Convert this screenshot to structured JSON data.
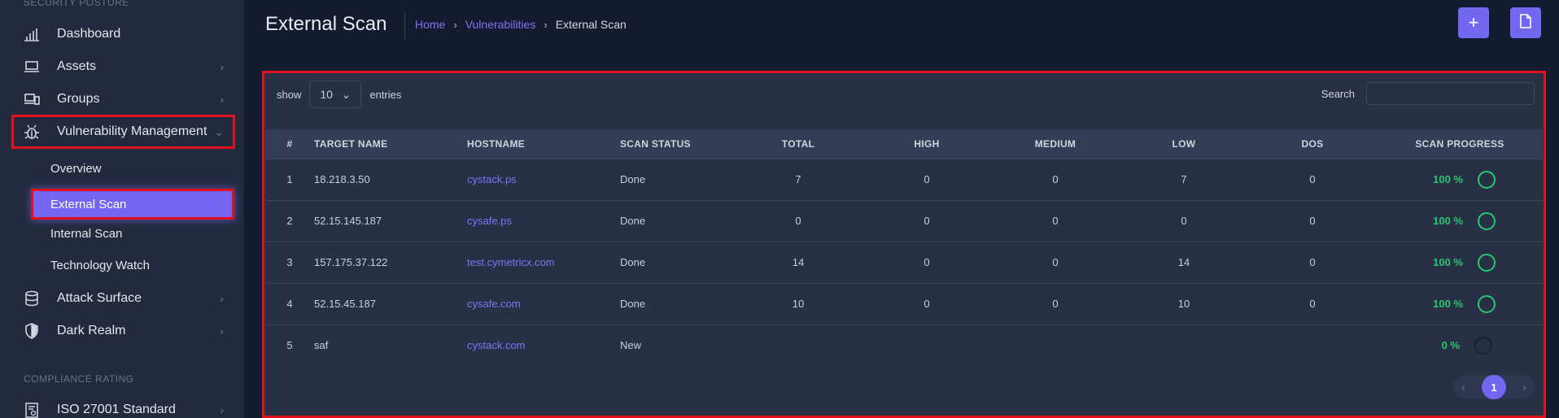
{
  "sidebar": {
    "section_top": "SECURITY POSTURE",
    "items": [
      {
        "label": "Dashboard",
        "icon": "chart-icon"
      },
      {
        "label": "Assets",
        "icon": "laptop-icon"
      },
      {
        "label": "Groups",
        "icon": "devices-icon"
      },
      {
        "label": "Vulnerability Management",
        "icon": "bug-icon"
      },
      {
        "label": "Attack Surface",
        "icon": "database-icon"
      },
      {
        "label": "Dark Realm",
        "icon": "shield-icon"
      }
    ],
    "sub_items": [
      "Overview",
      "External Scan",
      "Internal Scan",
      "Technology Watch"
    ],
    "section_compliance": "COMPLIANCE RATING",
    "compliance_item": "ISO 27001 Standard"
  },
  "header": {
    "title": "External Scan",
    "breadcrumb": [
      "Home",
      "Vulnerabilities",
      "External Scan"
    ],
    "add_label": "+"
  },
  "table_controls": {
    "show": "show",
    "entries_value": "10",
    "entries": "entries",
    "search_label": "Search",
    "search_value": ""
  },
  "table": {
    "columns": [
      "#",
      "TARGET NAME",
      "HOSTNAME",
      "SCAN STATUS",
      "TOTAL",
      "HIGH",
      "MEDIUM",
      "LOW",
      "DOS",
      "SCAN PROGRESS"
    ],
    "rows": [
      {
        "n": "1",
        "target": "18.218.3.50",
        "host": "cystack.ps",
        "status": "Done",
        "total": "7",
        "high": "0",
        "medium": "0",
        "low": "7",
        "dos": "0",
        "progress": "100 %"
      },
      {
        "n": "2",
        "target": "52.15.145.187",
        "host": "cysafe.ps",
        "status": "Done",
        "total": "0",
        "high": "0",
        "medium": "0",
        "low": "0",
        "dos": "0",
        "progress": "100 %"
      },
      {
        "n": "3",
        "target": "157.175.37.122",
        "host": "test.cymetricx.com",
        "status": "Done",
        "total": "14",
        "high": "0",
        "medium": "0",
        "low": "14",
        "dos": "0",
        "progress": "100 %"
      },
      {
        "n": "4",
        "target": "52.15.45.187",
        "host": "cysafe.com",
        "status": "Done",
        "total": "10",
        "high": "0",
        "medium": "0",
        "low": "10",
        "dos": "0",
        "progress": "100 %"
      },
      {
        "n": "5",
        "target": "saf",
        "host": "cystack.com",
        "status": "New",
        "total": "",
        "high": "",
        "medium": "",
        "low": "",
        "dos": "",
        "progress": "0 %"
      }
    ]
  },
  "pagination": {
    "prev": "‹",
    "current": "1",
    "next": "›"
  },
  "colors": {
    "accent": "#7367f0",
    "success": "#28c76f",
    "highlight": "#e0111d"
  }
}
